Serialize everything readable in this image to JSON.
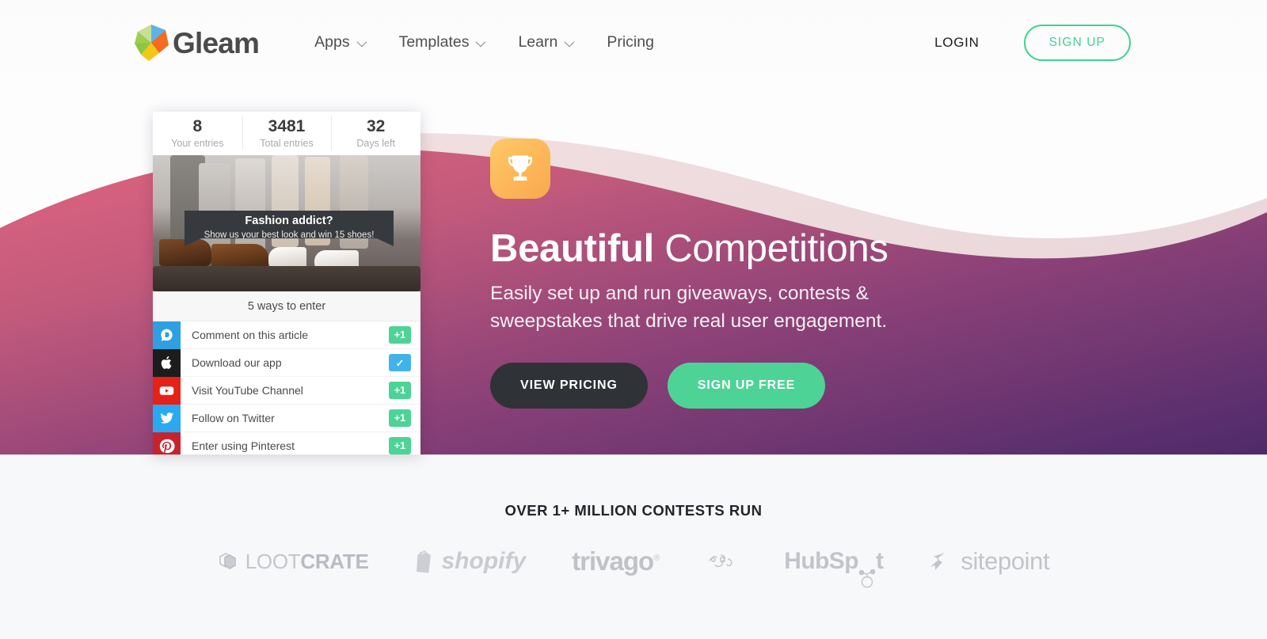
{
  "header": {
    "brand_name": "Gleam",
    "brand_logo_icon": "gleam-polygon-logo",
    "nav": [
      {
        "label": "Apps",
        "has_dropdown": true
      },
      {
        "label": "Templates",
        "has_dropdown": true
      },
      {
        "label": "Learn",
        "has_dropdown": true
      },
      {
        "label": "Pricing",
        "has_dropdown": false
      }
    ],
    "login_label": "LOGIN",
    "signup_label": "SIGN UP",
    "signup_color": "#3fd392"
  },
  "hero": {
    "trophy_icon": "trophy-icon",
    "title_bold": "Beautiful",
    "title_light": "Competitions",
    "subtitle": "Easily set up and run giveaways, contests & sweepstakes that drive real user engagement.",
    "cta_primary": "VIEW PRICING",
    "cta_secondary": "SIGN UP FREE",
    "cta_primary_color": "#2f3338",
    "cta_secondary_color": "#4ed396",
    "gradient_start": "#e0657f",
    "gradient_end": "#4e2a6b"
  },
  "widget": {
    "stats": [
      {
        "value": "8",
        "label": "Your entries"
      },
      {
        "value": "3481",
        "label": "Total entries"
      },
      {
        "value": "32",
        "label": "Days left"
      }
    ],
    "ribbon_title": "Fashion addict?",
    "ribbon_sub_before": "Show us your best look and win ",
    "ribbon_sub_link": "15 shoes",
    "ribbon_sub_after": "!",
    "ways_label": "5 ways to enter",
    "entries": [
      {
        "label": "Comment on this article",
        "icon": "disqus-icon",
        "icon_bg": "#2e9fe0",
        "badge": "+1",
        "badge_type": "plus"
      },
      {
        "label": "Download our app",
        "icon": "apple-icon",
        "icon_bg": "#1c1c1c",
        "badge": "✓",
        "badge_type": "done"
      },
      {
        "label": "Visit YouTube Channel",
        "icon": "youtube-icon",
        "icon_bg": "#e62117",
        "badge": "+1",
        "badge_type": "plus"
      },
      {
        "label": "Follow on Twitter",
        "icon": "twitter-icon",
        "icon_bg": "#29a9f1",
        "badge": "+1",
        "badge_type": "plus"
      },
      {
        "label": "Enter using Pinterest",
        "icon": "pinterest-icon",
        "icon_bg": "#c8232c",
        "badge": "+1",
        "badge_type": "plus"
      }
    ]
  },
  "logos": {
    "title": "OVER 1+ MILLION CONTESTS RUN",
    "brands": [
      {
        "name": "lootcrate-logo",
        "part1": "LOOT",
        "part2": "CRATE"
      },
      {
        "name": "shopify-logo",
        "text": "shopify"
      },
      {
        "name": "trivago-logo",
        "text": "trivago"
      },
      {
        "name": "razer-logo",
        "text": ""
      },
      {
        "name": "hubspot-logo",
        "text": "HubSp"
      },
      {
        "name": "hubspot-logo-tail",
        "text": "t"
      },
      {
        "name": "sitepoint-logo",
        "text": "sitepoint"
      }
    ]
  }
}
